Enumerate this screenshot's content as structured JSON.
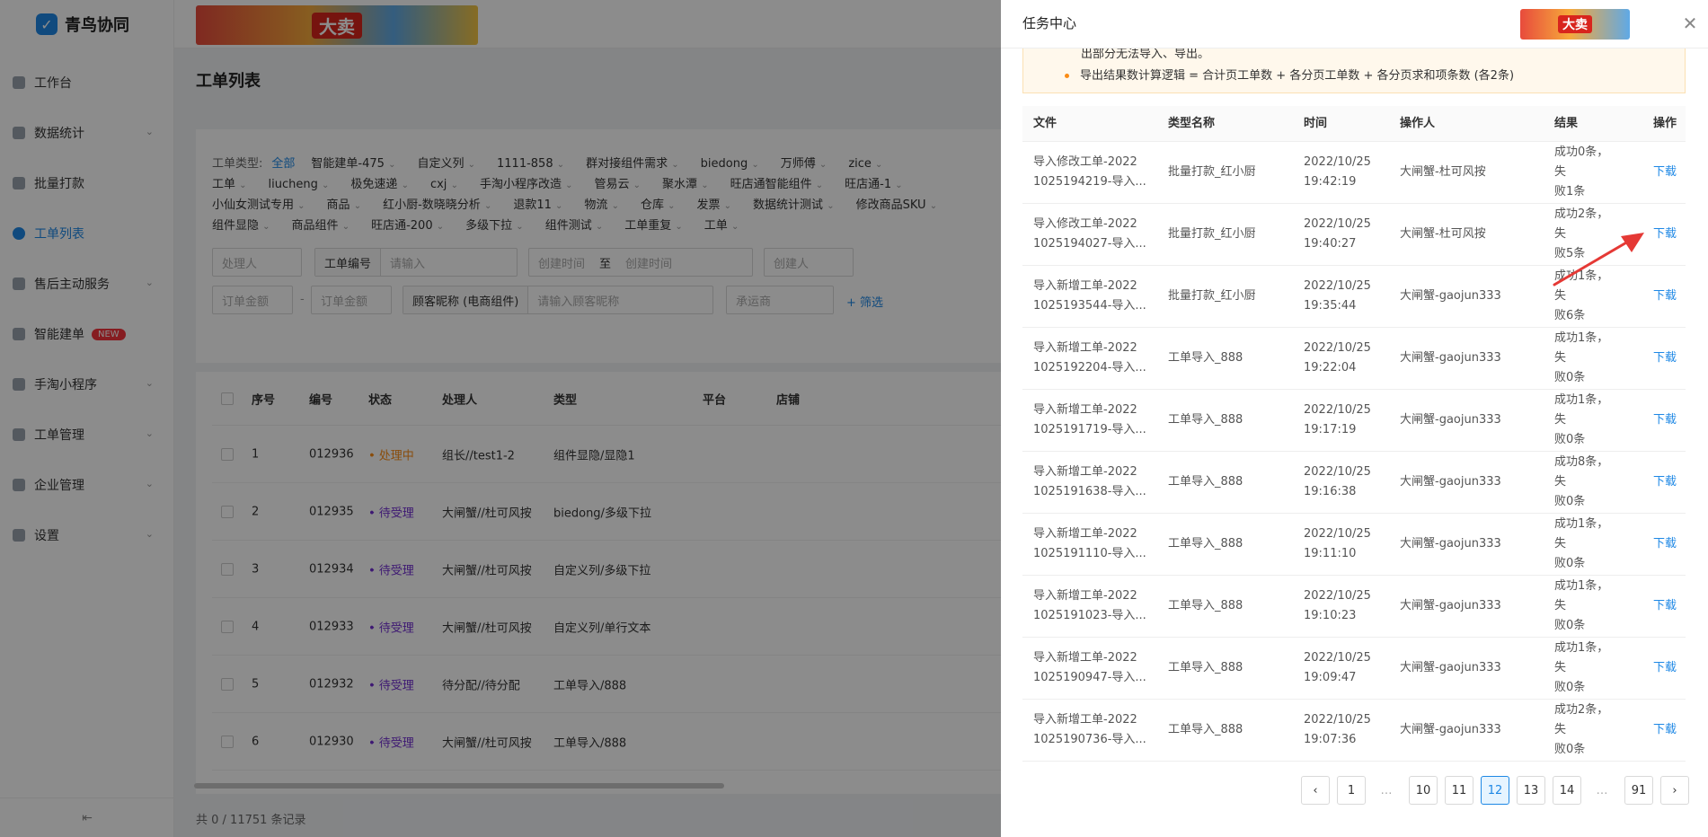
{
  "app": {
    "name": "青鸟协同"
  },
  "sidebar": {
    "items": [
      {
        "label": "工作台"
      },
      {
        "label": "数据统计"
      },
      {
        "label": "批量打款"
      },
      {
        "label": "工单列表"
      },
      {
        "label": "售后主动服务"
      },
      {
        "label": "智能建单",
        "badge": "NEW"
      },
      {
        "label": "手淘小程序"
      },
      {
        "label": "工单管理"
      },
      {
        "label": "企业管理"
      },
      {
        "label": "设置"
      }
    ],
    "collapse_icon": "collapse-icon"
  },
  "banner": {
    "text": "大卖"
  },
  "page": {
    "title": "工单列表"
  },
  "filters": {
    "type_label": "工单类型:",
    "type_all": "全部",
    "type_options": [
      "智能建单-475",
      "自定义列",
      "1111-858",
      "群对接组件需求",
      "biedong",
      "万师傅",
      "zice",
      "工单",
      "liucheng",
      "极免速递",
      "cxj",
      "手淘小程序改造",
      "管易云",
      "聚水潭",
      "旺店通智能组件",
      "旺店通-1",
      "小仙女测试专用",
      "商品",
      "红小厨-数晓晓分析",
      "退款11",
      "物流",
      "仓库",
      "发票",
      "数据统计测试",
      "修改商品SKU",
      "组件显隐",
      "商品组件",
      "旺店通-200",
      "多级下拉",
      "组件测试",
      "工单重复",
      "工单"
    ],
    "handler_placeholder": "处理人",
    "order_no_label": "工单编号",
    "order_no_placeholder": "请输入",
    "create_time_start": "创建时间",
    "create_time_sep": "至",
    "create_time_end": "创建时间",
    "creator_placeholder": "创建人",
    "amount_min": "订单金额",
    "amount_sep": "-",
    "amount_max": "订单金额",
    "buyer_label": "顾客昵称 (电商组件)",
    "buyer_placeholder": "请输入顾客昵称",
    "carrier_placeholder": "承运商",
    "filter_link": "+ 筛选"
  },
  "table": {
    "headers": [
      "序号",
      "编号",
      "状态",
      "处理人",
      "类型",
      "平台",
      "店铺"
    ],
    "rows": [
      {
        "idx": "1",
        "no": "012936",
        "status": "• 处理中",
        "handler": "组长//test1-2",
        "type": "组件显隐/显隐1"
      },
      {
        "idx": "2",
        "no": "012935",
        "status": "• 待受理",
        "handler": "大闸蟹//杜可风按",
        "type": "biedong/多级下拉"
      },
      {
        "idx": "3",
        "no": "012934",
        "status": "• 待受理",
        "handler": "大闸蟹//杜可风按",
        "type": "自定义列/多级下拉"
      },
      {
        "idx": "4",
        "no": "012933",
        "status": "• 待受理",
        "handler": "大闸蟹//杜可风按",
        "type": "自定义列/单行文本"
      },
      {
        "idx": "5",
        "no": "012932",
        "status": "• 待受理",
        "handler": "待分配//待分配",
        "type": "工单导入/888"
      },
      {
        "idx": "6",
        "no": "012930",
        "status": "• 待受理",
        "handler": "大闸蟹//杜可风按",
        "type": "工单导入/888"
      }
    ],
    "footer": "共 0 / 11751 条记录"
  },
  "drawer": {
    "title": "任务中心",
    "banner_text": "大卖",
    "notice": {
      "line1": "出部分无法导入、导出。",
      "line2": "导出结果数计算逻辑 = 合计页工单数 + 各分页工单数 + 各分页求和项条数 (各2条)"
    },
    "headers": [
      "文件",
      "类型名称",
      "时间",
      "操作人",
      "结果",
      "操作"
    ],
    "rows": [
      {
        "file1": "导入修改工单-2022",
        "file2": "1025194219-导入...",
        "type": "批量打款_红小厨",
        "date": "2022/10/25",
        "time": "19:42:19",
        "operator": "大闸蟹-杜可风按",
        "res1": "成功0条，失",
        "res2": "败1条",
        "action": "下载"
      },
      {
        "file1": "导入修改工单-2022",
        "file2": "1025194027-导入...",
        "type": "批量打款_红小厨",
        "date": "2022/10/25",
        "time": "19:40:27",
        "operator": "大闸蟹-杜可风按",
        "res1": "成功2条，失",
        "res2": "败5条",
        "action": "下载"
      },
      {
        "file1": "导入新增工单-2022",
        "file2": "1025193544-导入...",
        "type": "批量打款_红小厨",
        "date": "2022/10/25",
        "time": "19:35:44",
        "operator": "大闸蟹-gaojun333",
        "res1": "成功1条，失",
        "res2": "败6条",
        "action": "下载"
      },
      {
        "file1": "导入新增工单-2022",
        "file2": "1025192204-导入...",
        "type": "工单导入_888",
        "date": "2022/10/25",
        "time": "19:22:04",
        "operator": "大闸蟹-gaojun333",
        "res1": "成功1条，失",
        "res2": "败0条",
        "action": "下载"
      },
      {
        "file1": "导入新增工单-2022",
        "file2": "1025191719-导入...",
        "type": "工单导入_888",
        "date": "2022/10/25",
        "time": "19:17:19",
        "operator": "大闸蟹-gaojun333",
        "res1": "成功1条，失",
        "res2": "败0条",
        "action": "下载"
      },
      {
        "file1": "导入新增工单-2022",
        "file2": "1025191638-导入...",
        "type": "工单导入_888",
        "date": "2022/10/25",
        "time": "19:16:38",
        "operator": "大闸蟹-gaojun333",
        "res1": "成功8条，失",
        "res2": "败0条",
        "action": "下载"
      },
      {
        "file1": "导入新增工单-2022",
        "file2": "1025191110-导入...",
        "type": "工单导入_888",
        "date": "2022/10/25",
        "time": "19:11:10",
        "operator": "大闸蟹-gaojun333",
        "res1": "成功1条，失",
        "res2": "败0条",
        "action": "下载"
      },
      {
        "file1": "导入新增工单-2022",
        "file2": "1025191023-导入...",
        "type": "工单导入_888",
        "date": "2022/10/25",
        "time": "19:10:23",
        "operator": "大闸蟹-gaojun333",
        "res1": "成功1条，失",
        "res2": "败0条",
        "action": "下载"
      },
      {
        "file1": "导入新增工单-2022",
        "file2": "1025190947-导入...",
        "type": "工单导入_888",
        "date": "2022/10/25",
        "time": "19:09:47",
        "operator": "大闸蟹-gaojun333",
        "res1": "成功1条，失",
        "res2": "败0条",
        "action": "下载"
      },
      {
        "file1": "导入新增工单-2022",
        "file2": "1025190736-导入...",
        "type": "工单导入_888",
        "date": "2022/10/25",
        "time": "19:07:36",
        "operator": "大闸蟹-gaojun333",
        "res1": "成功2条，失",
        "res2": "败0条",
        "action": "下载"
      }
    ],
    "pagination": {
      "pages": [
        "1",
        "…",
        "10",
        "11",
        "12",
        "13",
        "14",
        "…",
        "91"
      ],
      "current": "12"
    }
  },
  "colors": {
    "accent": "#1e88e5",
    "processing": "#fa8c16",
    "pending": "#722ed1",
    "annotation_arrow": "#e53935"
  }
}
